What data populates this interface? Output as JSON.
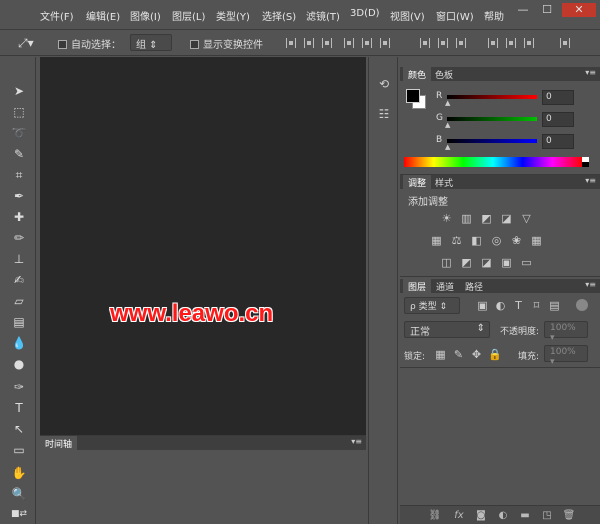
{
  "menubar": {
    "items": [
      "文件(F)",
      "编辑(E)",
      "图像(I)",
      "图层(L)",
      "类型(Y)",
      "选择(S)",
      "滤镜(T)",
      "3D(D)",
      "视图(V)",
      "窗口(W)",
      "帮助"
    ],
    "window_controls": [
      "—",
      "☐",
      "✕"
    ]
  },
  "options": {
    "auto_select_label": "自动选择：",
    "auto_select_value": "组",
    "show_transform_label": "显示变换控件"
  },
  "canvas": {
    "watermark": "www.leawo.cn"
  },
  "timeline": {
    "tab": "时间轴"
  },
  "color_panel": {
    "tabs": [
      "颜色",
      "色板"
    ],
    "channels": [
      {
        "label": "R",
        "value": "0",
        "color": "#ff0000"
      },
      {
        "label": "G",
        "value": "0",
        "color": "#00c000"
      },
      {
        "label": "B",
        "value": "0",
        "color": "#0000ff"
      }
    ]
  },
  "adjust_panel": {
    "tabs": [
      "调整",
      "样式"
    ],
    "title": "添加调整"
  },
  "layers_panel": {
    "tabs": [
      "图层",
      "通道",
      "路径"
    ],
    "filter_label": "ρ 类型",
    "blend_mode": "正常",
    "opacity_label": "不透明度:",
    "opacity_value": "100%",
    "lock_label": "锁定:",
    "fill_label": "填充:",
    "fill_value": "100%"
  }
}
